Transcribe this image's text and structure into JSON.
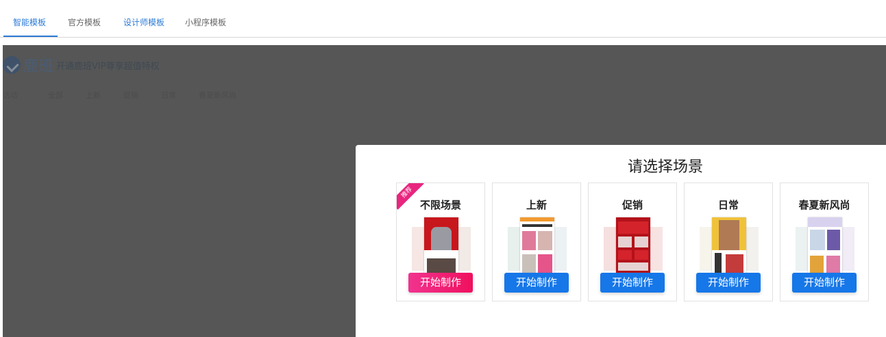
{
  "tabs": [
    {
      "label": "智能模板",
      "active": true
    },
    {
      "label": "官方模板",
      "active": false
    },
    {
      "label": "设计师模板",
      "active": false
    },
    {
      "label": "小程序模板",
      "active": false
    }
  ],
  "background": {
    "brand": "鹿班",
    "promo": "开通鹿班VIP尊享超值特权",
    "categories": [
      "活动",
      "全部",
      "上新",
      "促销",
      "日常",
      "春夏新风尚"
    ]
  },
  "modal": {
    "title": "请选择场景",
    "cards": [
      {
        "title": "不限场景",
        "ribbon": "推荐",
        "button": "开始制作",
        "button_style": "pink"
      },
      {
        "title": "上新",
        "button": "开始制作",
        "button_style": "blue"
      },
      {
        "title": "促销",
        "button": "开始制作",
        "button_style": "blue"
      },
      {
        "title": "日常",
        "button": "开始制作",
        "button_style": "blue"
      },
      {
        "title": "春夏新风尚",
        "button": "开始制作",
        "button_style": "blue"
      }
    ]
  },
  "colors": {
    "accent": "#2b7bd6",
    "overlay": "#565656",
    "pink_button": "#f0105e",
    "blue_button": "#1677e8"
  }
}
